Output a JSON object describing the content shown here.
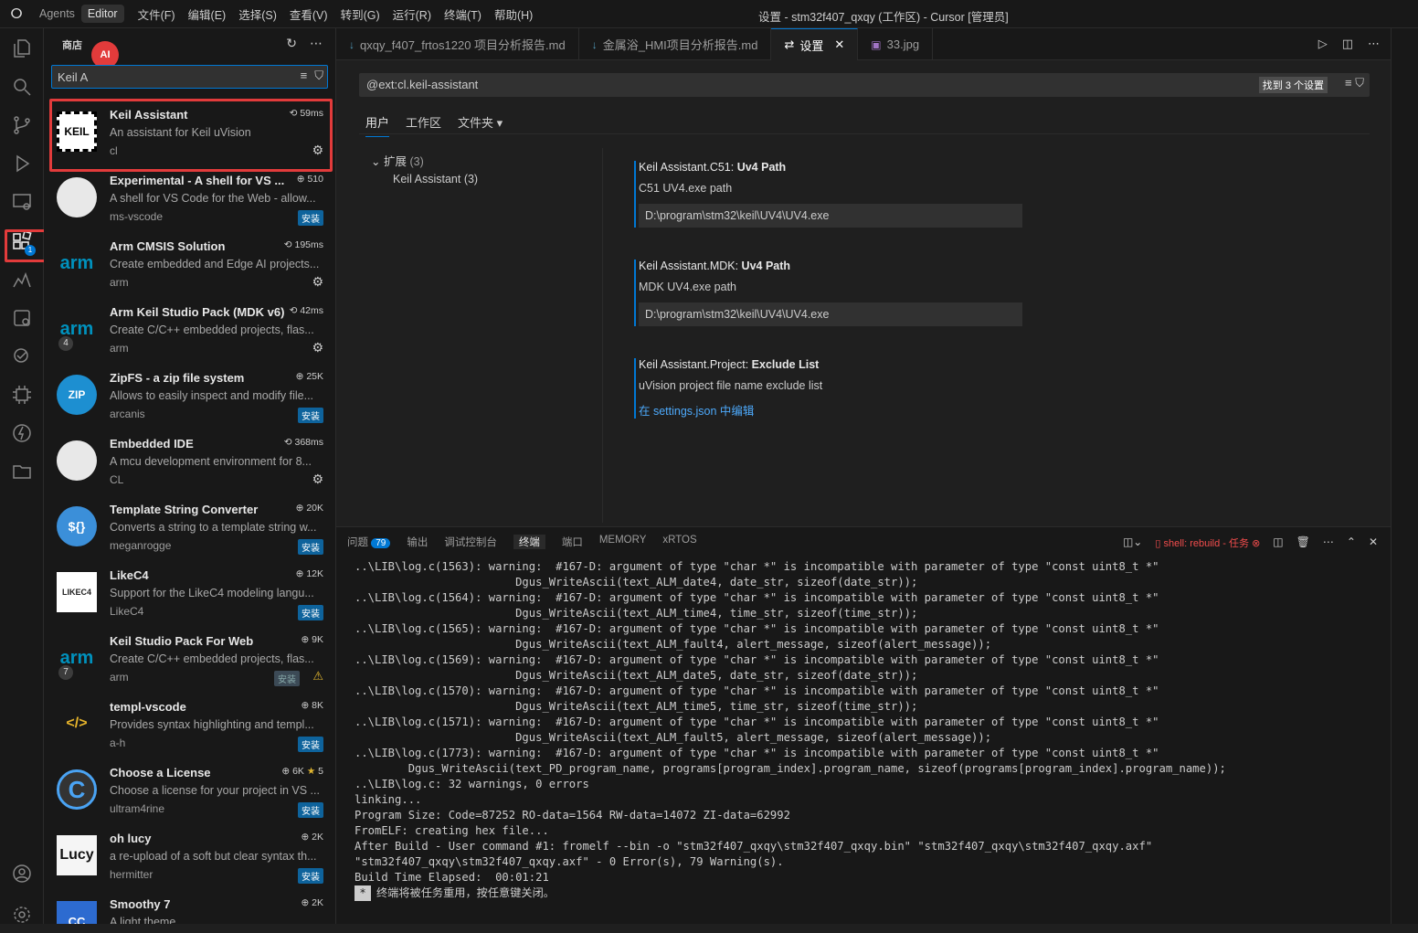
{
  "titlebar": {
    "logo": "cursor-logo",
    "agents": "Agents",
    "editor": "Editor",
    "menus": [
      "文件(F)",
      "编辑(E)",
      "选择(S)",
      "查看(V)",
      "转到(G)",
      "运行(R)",
      "终端(T)",
      "帮助(H)"
    ],
    "window_title": "设置 - stm32f407_qxqy (工作区) - Cursor [管理员]"
  },
  "activity": {
    "ext_badge": "1"
  },
  "sidebar": {
    "title": "商店",
    "ai_badge": "AI",
    "search_value": "Keil A",
    "extensions": [
      {
        "name": "Keil Assistant",
        "desc": "An assistant for Keil uVision",
        "publisher": "cl",
        "meta": "59ms",
        "action": "gear",
        "icon": "KEIL"
      },
      {
        "name": "Experimental - A shell for VS ...",
        "desc": "A shell for VS Code for the Web - allow...",
        "publisher": "ms-vscode",
        "meta": "510",
        "action": "安装",
        "icon": ""
      },
      {
        "name": "Arm CMSIS Solution",
        "desc": "Create embedded and Edge AI projects...",
        "publisher": "arm",
        "meta": "195ms",
        "action": "gear",
        "icon": "arm"
      },
      {
        "name": "Arm Keil Studio Pack (MDK v6)",
        "desc": "Create C/C++ embedded projects, flas...",
        "publisher": "arm",
        "meta": "42ms",
        "action": "gear",
        "icon": "arm",
        "count": "4"
      },
      {
        "name": "ZipFS - a zip file system",
        "desc": "Allows to easily inspect and modify file...",
        "publisher": "arcanis",
        "meta": "25K",
        "action": "安装",
        "icon": "ZIP"
      },
      {
        "name": "Embedded IDE",
        "desc": "A mcu development environment for 8...",
        "publisher": "CL",
        "meta": "368ms",
        "action": "gear",
        "icon": ""
      },
      {
        "name": "Template String Converter",
        "desc": "Converts a string to a template string w...",
        "publisher": "meganrogge",
        "meta": "20K",
        "action": "安装",
        "icon": "${}"
      },
      {
        "name": "LikeC4",
        "desc": "Support for the LikeC4 modeling langu...",
        "publisher": "LikeC4",
        "meta": "12K",
        "action": "安装",
        "icon": "LIKEC4"
      },
      {
        "name": "Keil Studio Pack For Web",
        "desc": "Create C/C++ embedded projects, flas...",
        "publisher": "arm",
        "meta": "9K",
        "action": "安装-dim",
        "icon": "arm",
        "count": "7"
      },
      {
        "name": "templ-vscode",
        "desc": "Provides syntax highlighting and templ...",
        "publisher": "a-h",
        "meta": "8K",
        "action": "安装",
        "icon": "</>"
      },
      {
        "name": "Choose a License",
        "desc": "Choose a license for your project in VS ...",
        "publisher": "ultram4rine",
        "meta": "6K",
        "rating": "5",
        "action": "安装",
        "icon": "C"
      },
      {
        "name": "oh lucy",
        "desc": "a re-upload of a soft but clear syntax th...",
        "publisher": "hermitter",
        "meta": "2K",
        "action": "安装",
        "icon": "Lucy"
      },
      {
        "name": "Smoothy 7",
        "desc": "A light theme",
        "publisher": "",
        "meta": "2K",
        "action": "",
        "icon": "CC"
      }
    ]
  },
  "tabs": [
    {
      "label": "qxqy_f407_frtos1220 项目分析报告.md",
      "icon": "↓"
    },
    {
      "label": "金属浴_HMI项目分析报告.md",
      "icon": "↓"
    },
    {
      "label": "设置",
      "icon": "⇄",
      "close": "✕"
    },
    {
      "label": "33.jpg",
      "icon": "▣"
    }
  ],
  "settings": {
    "search": "@ext:cl.keil-assistant",
    "found": "找到 3 个设置",
    "scope_tabs": [
      "用户",
      "工作区",
      "文件夹"
    ],
    "tree": {
      "group": "扩展",
      "group_count": "(3)",
      "child": "Keil Assistant (3)"
    },
    "items": [
      {
        "prefix": "Keil Assistant.C51: ",
        "title": "Uv4 Path",
        "desc": "C51 UV4.exe path",
        "value": "D:\\program\\stm32\\keil\\UV4\\UV4.exe"
      },
      {
        "prefix": "Keil Assistant.MDK: ",
        "title": "Uv4 Path",
        "desc": "MDK UV4.exe path",
        "value": "D:\\program\\stm32\\keil\\UV4\\UV4.exe"
      },
      {
        "prefix": "Keil Assistant.Project: ",
        "title": "Exclude List",
        "desc": "uVision project file name exclude list",
        "link": "在 settings.json 中编辑"
      }
    ]
  },
  "panel": {
    "tabs": [
      "问题",
      "输出",
      "调试控制台",
      "终端",
      "端口",
      "MEMORY",
      "xRTOS"
    ],
    "problems_count": "79",
    "task": "shell: rebuild - 任务",
    "terminal_lines": [
      "..\\LIB\\log.c(1563): warning:  #167-D: argument of type \"char *\" is incompatible with parameter of type \"const uint8_t *\"",
      "                        Dgus_WriteAscii(text_ALM_date4, date_str, sizeof(date_str));",
      "..\\LIB\\log.c(1564): warning:  #167-D: argument of type \"char *\" is incompatible with parameter of type \"const uint8_t *\"",
      "                        Dgus_WriteAscii(text_ALM_time4, time_str, sizeof(time_str));",
      "..\\LIB\\log.c(1565): warning:  #167-D: argument of type \"char *\" is incompatible with parameter of type \"const uint8_t *\"",
      "                        Dgus_WriteAscii(text_ALM_fault4, alert_message, sizeof(alert_message));",
      "..\\LIB\\log.c(1569): warning:  #167-D: argument of type \"char *\" is incompatible with parameter of type \"const uint8_t *\"",
      "                        Dgus_WriteAscii(text_ALM_date5, date_str, sizeof(date_str));",
      "..\\LIB\\log.c(1570): warning:  #167-D: argument of type \"char *\" is incompatible with parameter of type \"const uint8_t *\"",
      "                        Dgus_WriteAscii(text_ALM_time5, time_str, sizeof(time_str));",
      "..\\LIB\\log.c(1571): warning:  #167-D: argument of type \"char *\" is incompatible with parameter of type \"const uint8_t *\"",
      "                        Dgus_WriteAscii(text_ALM_fault5, alert_message, sizeof(alert_message));",
      "..\\LIB\\log.c(1773): warning:  #167-D: argument of type \"char *\" is incompatible with parameter of type \"const uint8_t *\"",
      "        Dgus_WriteAscii(text_PD_program_name, programs[program_index].program_name, sizeof(programs[program_index].program_name));",
      "..\\LIB\\log.c: 32 warnings, 0 errors",
      "linking...",
      "Program Size: Code=87252 RO-data=1564 RW-data=14072 ZI-data=62992",
      "FromELF: creating hex file...",
      "After Build - User command #1: fromelf --bin -o \"stm32f407_qxqy\\stm32f407_qxqy.bin\" \"stm32f407_qxqy\\stm32f407_qxqy.axf\"",
      "\"stm32f407_qxqy\\stm32f407_qxqy.axf\" - 0 Error(s), 79 Warning(s).",
      "Build Time Elapsed:  00:01:21"
    ],
    "last_line": "终端将被任务重用，按任意键关闭。",
    "last_marker": "*"
  },
  "colors": {
    "accent": "#0078d4",
    "highlight": "#e23b3b",
    "install": "#0e639c"
  }
}
